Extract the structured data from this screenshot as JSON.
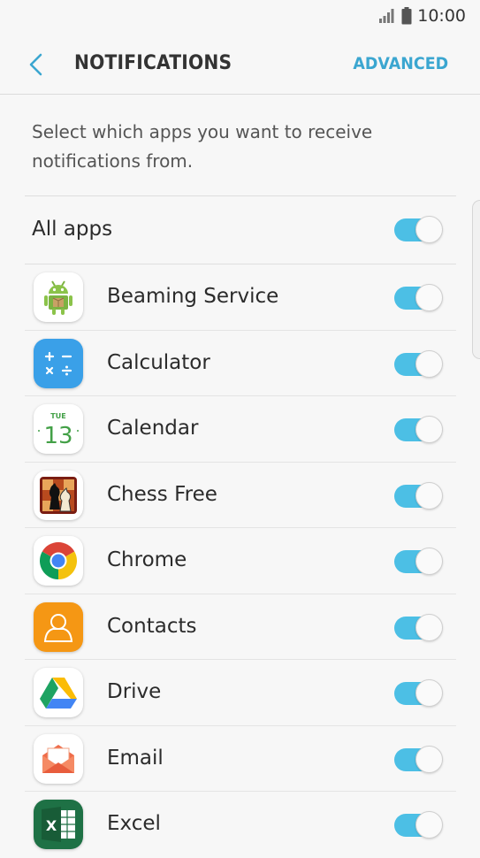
{
  "status_bar": {
    "time": "10:00",
    "signal_icon": "signal-icon",
    "battery_icon": "battery-icon"
  },
  "header": {
    "title": "NOTIFICATIONS",
    "action_label": "ADVANCED",
    "back_icon": "back-arrow-icon"
  },
  "description": "Select which apps you want to receive notifications from.",
  "all_apps": {
    "label": "All apps",
    "enabled": true
  },
  "colors": {
    "accent": "#3ba6d0",
    "toggle_on": "#4cbfe5"
  },
  "apps": [
    {
      "label": "Beaming Service",
      "icon": "android-robot-icon",
      "enabled": true
    },
    {
      "label": "Calculator",
      "icon": "calculator-icon",
      "enabled": true
    },
    {
      "label": "Calendar",
      "icon": "calendar-icon",
      "icon_day": "TUE",
      "icon_date": "13",
      "enabled": true
    },
    {
      "label": "Chess Free",
      "icon": "chess-icon",
      "enabled": true
    },
    {
      "label": "Chrome",
      "icon": "chrome-icon",
      "enabled": true
    },
    {
      "label": "Contacts",
      "icon": "contacts-icon",
      "enabled": true
    },
    {
      "label": "Drive",
      "icon": "drive-icon",
      "enabled": true
    },
    {
      "label": "Email",
      "icon": "email-icon",
      "enabled": true
    },
    {
      "label": "Excel",
      "icon": "excel-icon",
      "enabled": true
    }
  ]
}
